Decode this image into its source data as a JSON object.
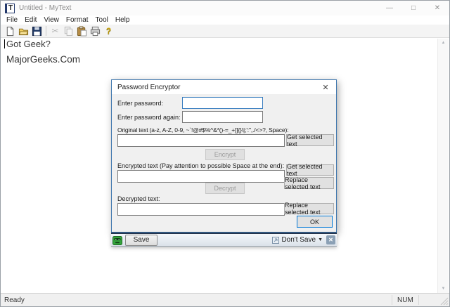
{
  "window": {
    "title": "Untitled - MyText",
    "app_icon_letter": "T"
  },
  "glyphs": {
    "minimize": "—",
    "maximize": "□",
    "close": "✕",
    "dialog_close": "✕",
    "bar_close": "✕",
    "dropdown": "▼",
    "scroll_up": "▲",
    "scroll_down": "▼",
    "cut": "✂",
    "help": "?"
  },
  "menu": {
    "items": [
      "File",
      "Edit",
      "View",
      "Format",
      "Tool",
      "Help"
    ]
  },
  "toolbar": {
    "icons": [
      "new",
      "open",
      "save",
      "cut",
      "copy",
      "paste",
      "print",
      "help"
    ]
  },
  "document": {
    "line1": "Got Geek?",
    "line2": "MajorGeeks.Com"
  },
  "dialog": {
    "title": "Password Encryptor",
    "labels": {
      "password": "Enter password:",
      "password_again": "Enter password again:",
      "original": "Original text (a-z, A-Z, 0-9, ~`!@#$%^&*()-=_+[]{}\\|;':\",./<>?, Space):",
      "encrypted": "Encrypted text (Pay attention to possible Space at the end):",
      "decrypted": "Decrypted text:"
    },
    "buttons": {
      "get_selected_1": "Get selected text",
      "get_selected_2": "Get selected text",
      "replace_selected_1": "Replace selected text",
      "replace_selected_2": "Replace selected text",
      "encrypt": "Encrypt",
      "decrypt": "Decrypt",
      "ok": "OK"
    },
    "inputs": {
      "password_value": "",
      "password_again_value": "",
      "original_value": "",
      "encrypted_value": "",
      "decrypted_value": ""
    }
  },
  "save_bar": {
    "save_label": "Save",
    "dont_save_label": "Don't Save"
  },
  "status_bar": {
    "message": "Ready",
    "num_lock": "NUM"
  },
  "colors": {
    "accent_blue": "#0078d7",
    "dialog_border": "#3f77ae",
    "save_bar_green": "#35a33c",
    "save_bar_top": "#25364f"
  }
}
